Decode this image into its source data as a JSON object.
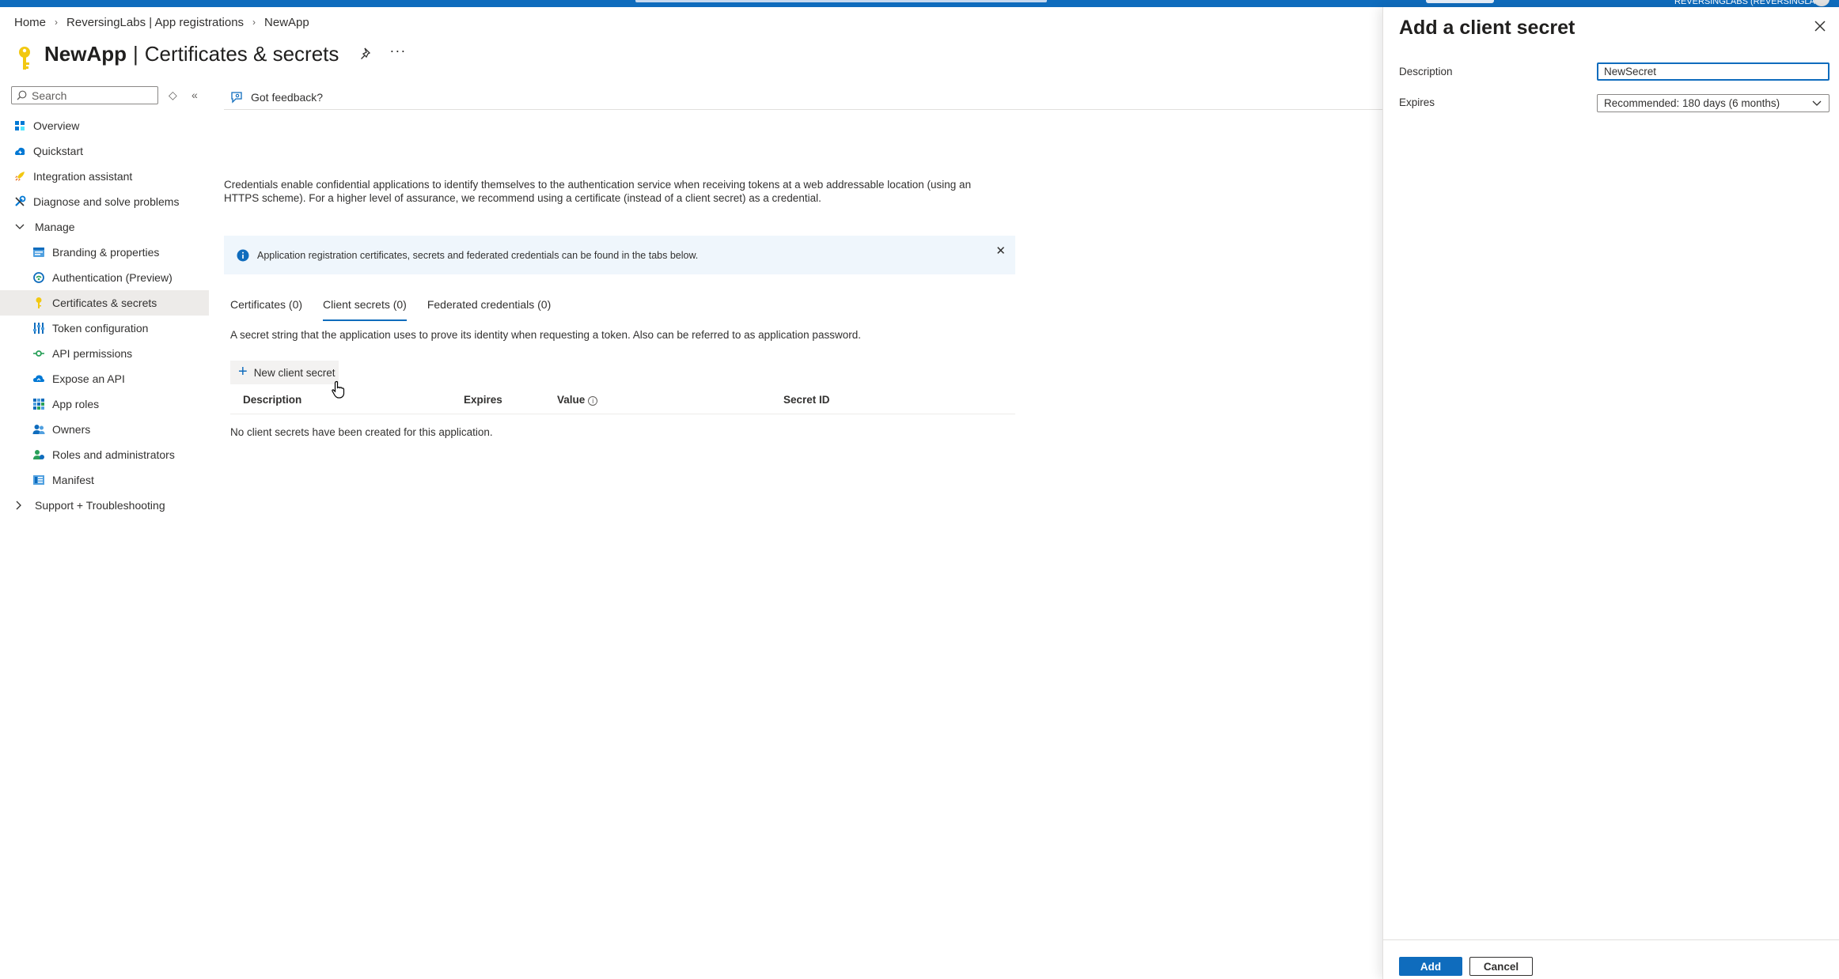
{
  "topbar": {
    "account": "REVERSINGLABS (REVERSINGLAB..."
  },
  "breadcrumb": [
    "Home",
    "ReversingLabs | App registrations",
    "NewApp"
  ],
  "header": {
    "title": "NewApp",
    "separator": "|",
    "subtitle": "Certificates & secrets",
    "more": "···",
    "icon": "key-icon"
  },
  "sidebar": {
    "search_placeholder": "Search",
    "items": [
      {
        "label": "Overview",
        "icon": "overview-icon",
        "level": 0
      },
      {
        "label": "Quickstart",
        "icon": "quickstart-icon",
        "level": 0
      },
      {
        "label": "Integration assistant",
        "icon": "rocket-icon",
        "level": 0
      },
      {
        "label": "Diagnose and solve problems",
        "icon": "wrench-icon",
        "level": 0
      },
      {
        "label": "Manage",
        "icon": "chevron-down-icon",
        "level": 0,
        "group": true
      },
      {
        "label": "Branding & properties",
        "icon": "branding-icon",
        "level": 1
      },
      {
        "label": "Authentication (Preview)",
        "icon": "authentication-icon",
        "level": 1
      },
      {
        "label": "Certificates & secrets",
        "icon": "key-icon",
        "level": 1,
        "active": true
      },
      {
        "label": "Token configuration",
        "icon": "token-icon",
        "level": 1
      },
      {
        "label": "API permissions",
        "icon": "api-permissions-icon",
        "level": 1
      },
      {
        "label": "Expose an API",
        "icon": "cloud-icon",
        "level": 1
      },
      {
        "label": "App roles",
        "icon": "app-roles-icon",
        "level": 1
      },
      {
        "label": "Owners",
        "icon": "owners-icon",
        "level": 1
      },
      {
        "label": "Roles and administrators",
        "icon": "roles-icon",
        "level": 1
      },
      {
        "label": "Manifest",
        "icon": "manifest-icon",
        "level": 1
      },
      {
        "label": "Support + Troubleshooting",
        "icon": "chevron-right-icon",
        "level": 0,
        "group": true
      }
    ]
  },
  "main": {
    "feedback": "Got feedback?",
    "intro": "Credentials enable confidential applications to identify themselves to the authentication service when receiving tokens at a web addressable location (using an HTTPS scheme). For a higher level of assurance, we recommend using a certificate (instead of a client secret) as a credential.",
    "info_banner": "Application registration certificates, secrets and federated credentials can be found in the tabs below.",
    "tabs": [
      {
        "label": "Certificates (0)",
        "active": false
      },
      {
        "label": "Client secrets (0)",
        "active": true
      },
      {
        "label": "Federated credentials (0)",
        "active": false
      }
    ],
    "tab_description": "A secret string that the application uses to prove its identity when requesting a token. Also can be referred to as application password.",
    "new_button": "New client secret",
    "table": {
      "columns": [
        "Description",
        "Expires",
        "Value",
        "Secret ID"
      ],
      "empty_message": "No client secrets have been created for this application."
    }
  },
  "panel": {
    "title": "Add a client secret",
    "description_label": "Description",
    "description_value": "NewSecret",
    "expires_label": "Expires",
    "expires_value": "Recommended: 180 days (6 months)",
    "add_button": "Add",
    "cancel_button": "Cancel"
  },
  "colors": {
    "accent": "#0f6cbd",
    "info_background": "#eff6fc",
    "nav_active": "#edebe9"
  }
}
